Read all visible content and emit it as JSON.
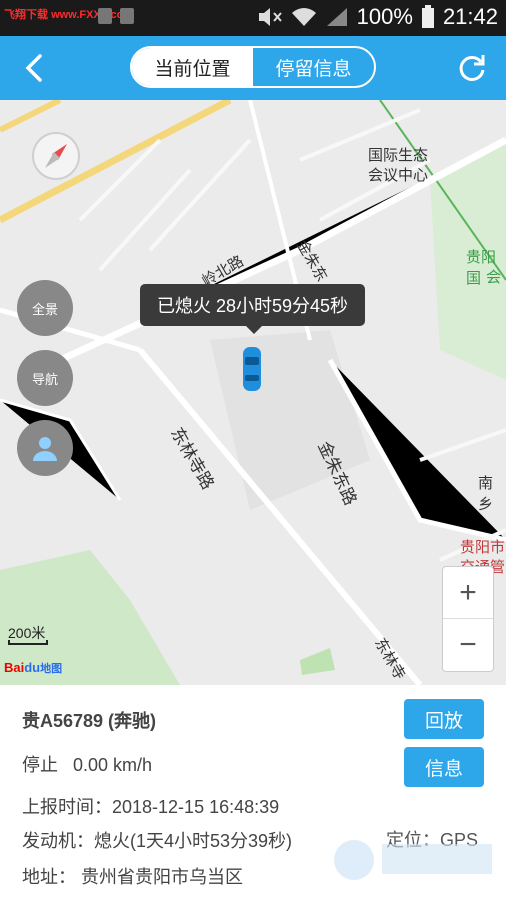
{
  "status": {
    "watermark_prefix": "飞翔下载",
    "watermark_url": "www.FXXZ.com",
    "battery": "100%",
    "time": "21:42"
  },
  "header": {
    "tabs": [
      {
        "label": "当前位置",
        "active": true
      },
      {
        "label": "停留信息",
        "active": false
      }
    ]
  },
  "map": {
    "tooltip": "已熄火 28小时59分45秒",
    "buttons": {
      "panorama": "全景",
      "navigate": "导航"
    },
    "scale": "200米",
    "logo": {
      "bai": "Bai",
      "du": "du",
      "rest": "地图"
    },
    "labels": {
      "conference1": "国际生态",
      "conference2": "会议中心",
      "guiyang_top1": "贵阳国",
      "guiyang_top2": "会",
      "road_lingbei": "岭北路",
      "road_jinzhu": "金朱东",
      "road_donglin": "东林寺路",
      "road_jinzhu_dong": "金朱东路",
      "road_nan": "南乡",
      "guiyang_right1": "贵阳市",
      "guiyang_right2": "交通管",
      "road_donglin2": "东林寺"
    }
  },
  "vehicle": {
    "plate": "贵A56789 (奔驰)",
    "status_label": "停止",
    "speed": "0.00 km/h",
    "report_time": "上报时间：2018-12-15 16:48:39",
    "engine": "发动机：熄火(1天4小时53分39秒)",
    "locate": "定位：GPS",
    "address": "地址： 贵州省贵阳市乌当区"
  },
  "actions": {
    "replay": "回放",
    "info": "信息"
  },
  "colors": {
    "accent": "#2ea6ea",
    "car": "#1f8fdd"
  }
}
